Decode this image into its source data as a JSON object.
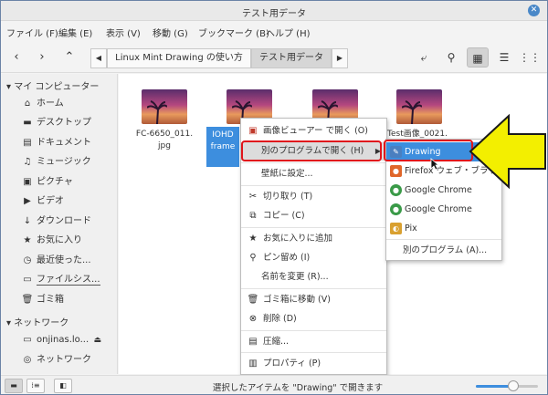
{
  "window": {
    "title": "テスト用データ",
    "close_icon": "close-icon"
  },
  "menu": [
    "ファイル (F)",
    "編集 (E)",
    "表示 (V)",
    "移動 (G)",
    "ブックマーク (B)",
    "ヘルプ (H)"
  ],
  "breadcrumbs": [
    "Linux Mint Drawing の使い方",
    "テスト用データ"
  ],
  "sidebar": {
    "computer_header": "マイ コンピューター",
    "places": [
      {
        "label": "ホーム",
        "icon": "home-icon"
      },
      {
        "label": "デスクトップ",
        "icon": "desktop-icon"
      },
      {
        "label": "ドキュメント",
        "icon": "document-icon"
      },
      {
        "label": "ミュージック",
        "icon": "music-icon"
      },
      {
        "label": "ピクチャ",
        "icon": "picture-icon"
      },
      {
        "label": "ビデオ",
        "icon": "video-icon"
      },
      {
        "label": "ダウンロード",
        "icon": "download-icon"
      },
      {
        "label": "お気に入り",
        "icon": "star-icon"
      },
      {
        "label": "最近使った...",
        "icon": "recent-icon"
      },
      {
        "label": "ファイルシス...",
        "icon": "filesystem-icon"
      },
      {
        "label": "ゴミ箱",
        "icon": "trash-icon"
      }
    ],
    "network_header": "ネットワーク",
    "network": [
      {
        "label": "onjinas.lo...",
        "icon": "network-share-icon"
      },
      {
        "label": "ネットワーク",
        "icon": "network-icon"
      }
    ]
  },
  "files": [
    {
      "name_line1": "FC-6650_011.",
      "name_line2": "jpg",
      "selected": false
    },
    {
      "name_line1": "IOHD",
      "name_line2": "frame",
      "selected": true
    },
    {
      "name_line1": "",
      "name_line2": "",
      "selected": false
    },
    {
      "name_line1": "Test画像_0021.",
      "name_line2": "",
      "selected": false
    }
  ],
  "context_menu": {
    "open_image_viewer": "画像ビューアー で開く (O)",
    "open_with": "別のプログラムで開く (H)",
    "set_wallpaper": "壁紙に設定...",
    "cut": "切り取り (T)",
    "copy": "コピー (C)",
    "add_favorite": "お気に入りに追加",
    "pin": "ピン留め (I)",
    "rename": "名前を変更 (R)...",
    "move_trash": "ゴミ箱に移動 (V)",
    "delete": "削除 (D)",
    "compress": "圧縮...",
    "properties": "プロパティ (P)"
  },
  "submenu": [
    {
      "label": "Drawing",
      "icon": "drawing-app-icon",
      "color": "#4a7fc0",
      "highlighted": true
    },
    {
      "label": "Firefox ウェブ・ブラウザ",
      "icon": "firefox-icon",
      "color": "#e0662a",
      "highlighted": false
    },
    {
      "label": "Google Chrome",
      "icon": "chrome-icon",
      "color": "#3a9a48",
      "highlighted": false
    },
    {
      "label": "Google Chrome",
      "icon": "chrome-icon",
      "color": "#3a9a48",
      "highlighted": false
    },
    {
      "label": "Pix",
      "icon": "pix-icon",
      "color": "#d9a030",
      "highlighted": false
    },
    {
      "label": "別のプログラム (A)...",
      "icon": "",
      "color": "",
      "highlighted": false
    }
  ],
  "status": {
    "text": "選択したアイテムを \"Drawing\" で開きます",
    "zoom_fraction": 0.6
  },
  "colors": {
    "selection": "#3d8ede",
    "annotation_red": "#e0161c",
    "annotation_yellow": "#f3ef00"
  }
}
